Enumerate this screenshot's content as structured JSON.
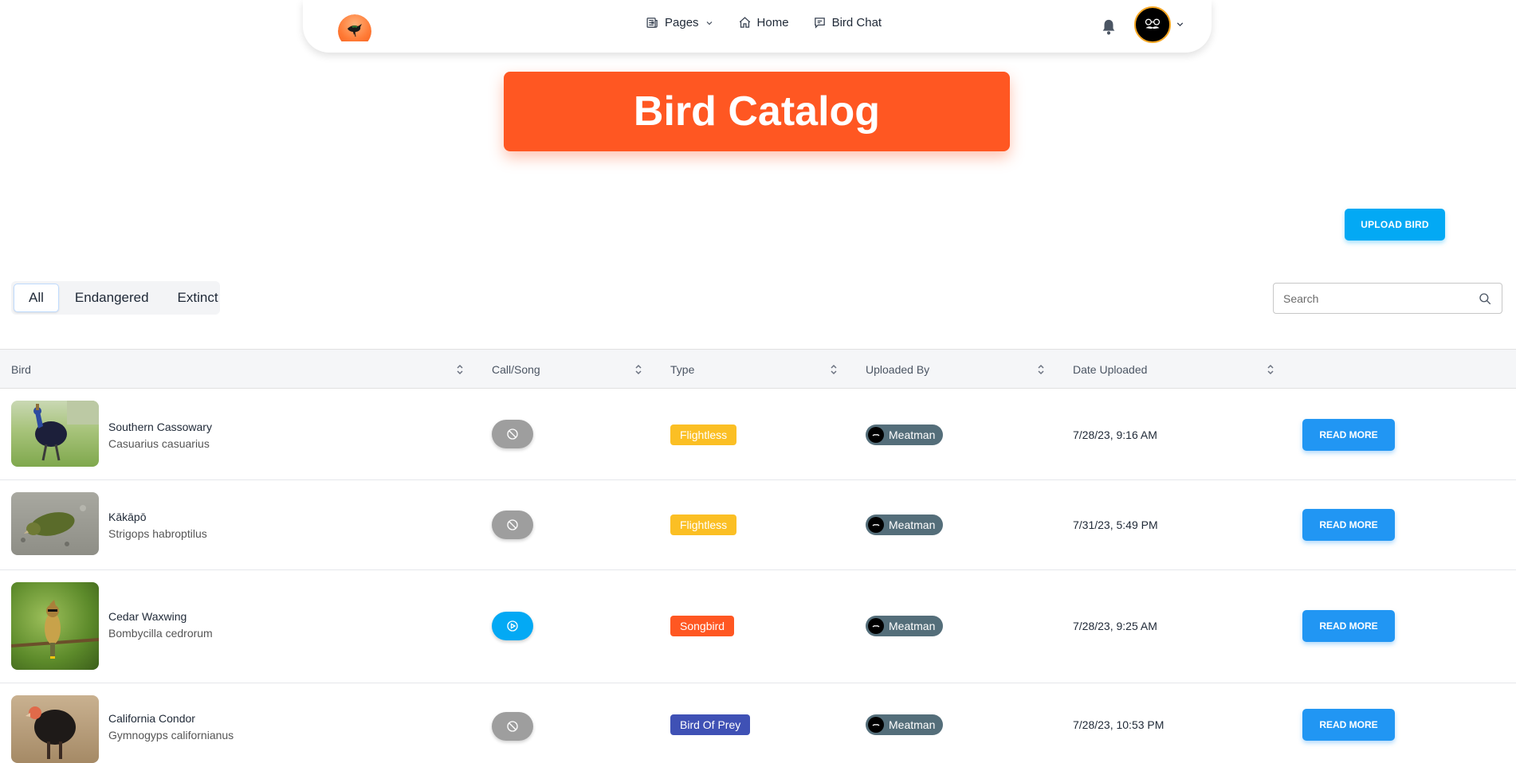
{
  "nav": {
    "pages_label": "Pages",
    "home_label": "Home",
    "chat_label": "Bird Chat"
  },
  "banner": {
    "title": "Bird Catalog"
  },
  "upload_label": "UPLOAD BIRD",
  "filters": {
    "all": "All",
    "endangered": "Endangered",
    "extinct": "Extinct",
    "selected": "All"
  },
  "search": {
    "placeholder": "Search"
  },
  "columns": {
    "bird": "Bird",
    "call": "Call/Song",
    "type": "Type",
    "uploaded_by": "Uploaded By",
    "date": "Date Uploaded"
  },
  "rows": [
    {
      "name": "Southern Cassowary",
      "scientific": "Casuarius casuarius",
      "call": "unavailable",
      "type": "Flightless",
      "type_color": "#fbbf24",
      "uploader": "Meatman",
      "date": "7/28/23, 9:16 AM",
      "action": "READ MORE"
    },
    {
      "name": "Kākāpō",
      "scientific": "Strigops habroptilus",
      "call": "unavailable",
      "type": "Flightless",
      "type_color": "#fbbf24",
      "uploader": "Meatman",
      "date": "7/31/23, 5:49 PM",
      "action": "READ MORE"
    },
    {
      "name": "Cedar Waxwing",
      "scientific": "Bombycilla cedrorum",
      "call": "play",
      "type": "Songbird",
      "type_color": "#ff5722",
      "uploader": "Meatman",
      "date": "7/28/23, 9:25 AM",
      "action": "READ MORE"
    },
    {
      "name": "California Condor",
      "scientific": "Gymnogyps californianus",
      "call": "unavailable",
      "type": "Bird Of Prey",
      "type_color": "#3f51b5",
      "uploader": "Meatman",
      "date": "7/28/23, 10:53 PM",
      "action": "READ MORE"
    }
  ],
  "colors": {
    "accent": "#ff5722",
    "primary": "#2196f3",
    "upload": "#03a9f4",
    "call_disabled": "#9e9e9e",
    "call_play": "#03a9f4",
    "user_chip": "#546e7a"
  }
}
